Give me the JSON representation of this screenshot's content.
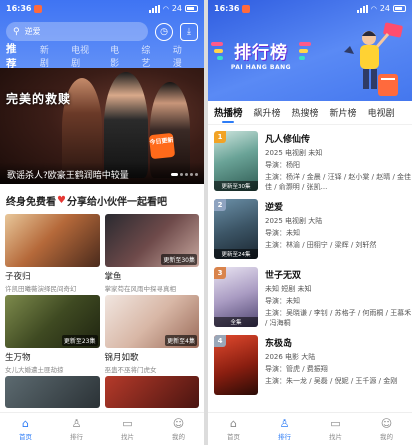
{
  "colors": {
    "primary_blue": "#3f74f3",
    "tab_active": "#2d7cf6",
    "rank_gold": "#f2a325",
    "rank_silver": "#8ea3c0",
    "rank_bronze": "#d9844c",
    "rank_plain": "#9aa7b8"
  },
  "left": {
    "status": {
      "time": "16:36",
      "battery": "24"
    },
    "search": {
      "placeholder": "逆爱",
      "icon": "search-icon"
    },
    "header_icons": [
      "history-icon",
      "download-icon"
    ],
    "tabs": [
      {
        "label": "推荐",
        "active": true
      },
      {
        "label": "新剧",
        "active": false
      },
      {
        "label": "电视剧",
        "active": false
      },
      {
        "label": "电影",
        "active": false
      },
      {
        "label": "综艺",
        "active": false
      },
      {
        "label": "动漫",
        "active": false
      }
    ],
    "banner": {
      "art_title": "完美的救赎",
      "caption": "歌谣杀人?欧豪王鹤润暗中较量",
      "sticker": "今日更新"
    },
    "section_title_a": "终身免费看",
    "section_title_b": "分享给小伙伴一起看吧",
    "cards": [
      {
        "name": "子夜归",
        "desc": "许凯田曦薇演绎民间奇幻",
        "badge": ""
      },
      {
        "name": "掌鱼",
        "desc": "掌家苟在风雨中探寻真相",
        "badge": "更新至30集"
      },
      {
        "name": "生万物",
        "desc": "女儿大婚遭土匪劫掠",
        "badge": "更新至23集"
      },
      {
        "name": "锦月如歌",
        "desc": "巫蛊不巫将门虎女",
        "badge": "更新至4集"
      },
      {
        "name": "",
        "desc": "",
        "badge": ""
      },
      {
        "name": "",
        "desc": "",
        "badge": ""
      }
    ],
    "tabbar": [
      {
        "label": "首页",
        "icon": "home-icon",
        "active": true
      },
      {
        "label": "排行",
        "icon": "ranking-icon",
        "active": false
      },
      {
        "label": "找片",
        "icon": "video-icon",
        "active": false
      },
      {
        "label": "我的",
        "icon": "user-icon",
        "active": false
      }
    ]
  },
  "right": {
    "status": {
      "time": "16:36",
      "battery": "24"
    },
    "hero": {
      "title": "排行榜",
      "subtitle": "PAI HANG BANG"
    },
    "tabs": [
      {
        "label": "热播榜",
        "active": true
      },
      {
        "label": "飙升榜",
        "active": false
      },
      {
        "label": "热搜榜",
        "active": false
      },
      {
        "label": "新片榜",
        "active": false
      },
      {
        "label": "电视剧",
        "active": false
      }
    ],
    "items": [
      {
        "rank": "1",
        "title": "凡人修仙传",
        "meta": "2025 电视剧 未知",
        "director": "导演：杨阳",
        "cast": "主演：杨洋 / 金晨 / 汪铎 / 赵小棠 / 赵晴 / 金佳佳 / 俞灏明 / 张凯...",
        "badge": "更新至30集"
      },
      {
        "rank": "2",
        "title": "逆爱",
        "meta": "2025 电视剧 大陆",
        "director": "导演：未知",
        "cast": "主演：林渝 / 田栩宁 / 梁辉 / 刘轩然",
        "badge": "更新至24集"
      },
      {
        "rank": "3",
        "title": "世子无双",
        "meta": "未知 短剧 未知",
        "director": "导演：未知",
        "cast": "主演：吴晓谦 / 李钊 / 苏格子 / 何雨桐 / 王慕禾 / 冯海桐",
        "badge": "全集"
      },
      {
        "rank": "4",
        "title": "东极岛",
        "meta": "2026 电影 大陆",
        "director": "导演：管虎 / 费振翔",
        "cast": "主演：朱一龙 / 吴磊 / 倪妮 / 王千源 / 金刚",
        "badge": ""
      }
    ],
    "tabbar": [
      {
        "label": "首页",
        "icon": "home-icon",
        "active": false
      },
      {
        "label": "排行",
        "icon": "ranking-icon",
        "active": true
      },
      {
        "label": "找片",
        "icon": "video-icon",
        "active": false
      },
      {
        "label": "我的",
        "icon": "user-icon",
        "active": false
      }
    ]
  }
}
